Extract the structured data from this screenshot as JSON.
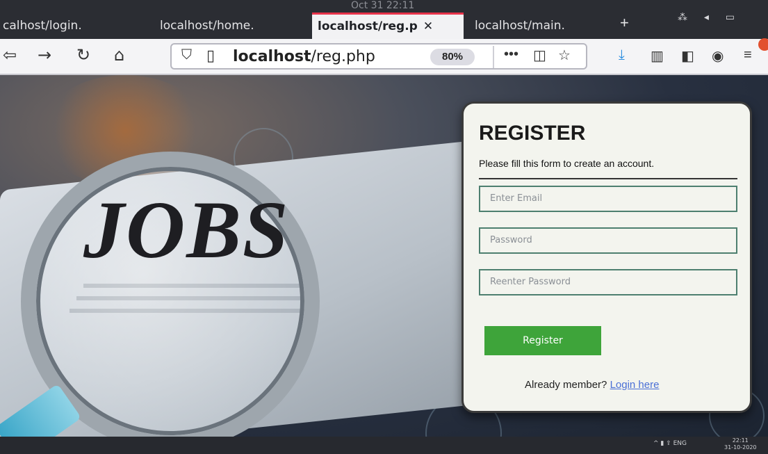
{
  "system": {
    "clock": "Oct 31  22:11"
  },
  "tabs": [
    {
      "label": "calhost/login.",
      "active": false
    },
    {
      "label": "localhost/home.",
      "active": false
    },
    {
      "label": "localhost/reg.p",
      "active": true,
      "close": "✕"
    },
    {
      "label": "localhost/main.",
      "active": false
    }
  ],
  "new_tab": "+",
  "toolbar": {
    "back_icon": "⇦",
    "forward_icon": "→",
    "reload_icon": "↻",
    "home_icon": "⌂",
    "url_host": "localhost",
    "url_path": "/reg.php",
    "zoom": "80%",
    "more_icon": "•••",
    "pocket_icon": "◫",
    "star_icon": "☆",
    "download_icon": "⤓",
    "library_icon": "▥",
    "sidebar_icon": "◧",
    "account_icon": "◉",
    "menu_icon": "≡"
  },
  "hero": {
    "word": "JOBS"
  },
  "form": {
    "title": "REGISTER",
    "subtitle": "Please fill this form to create an account.",
    "email_placeholder": "Enter Email",
    "password_placeholder": "Password",
    "reenter_placeholder": "Reenter Password",
    "submit_label": "Register",
    "footer_text": "Already member?",
    "login_link": "Login here"
  },
  "taskbar": {
    "tray_text": "^  ▮  ⇪  ENG",
    "time": "22:11",
    "date": "31-10-2020"
  },
  "colors": {
    "accent": "#3ea43a",
    "link": "#4a6fd6",
    "tab_indicator": "#e8334a"
  }
}
